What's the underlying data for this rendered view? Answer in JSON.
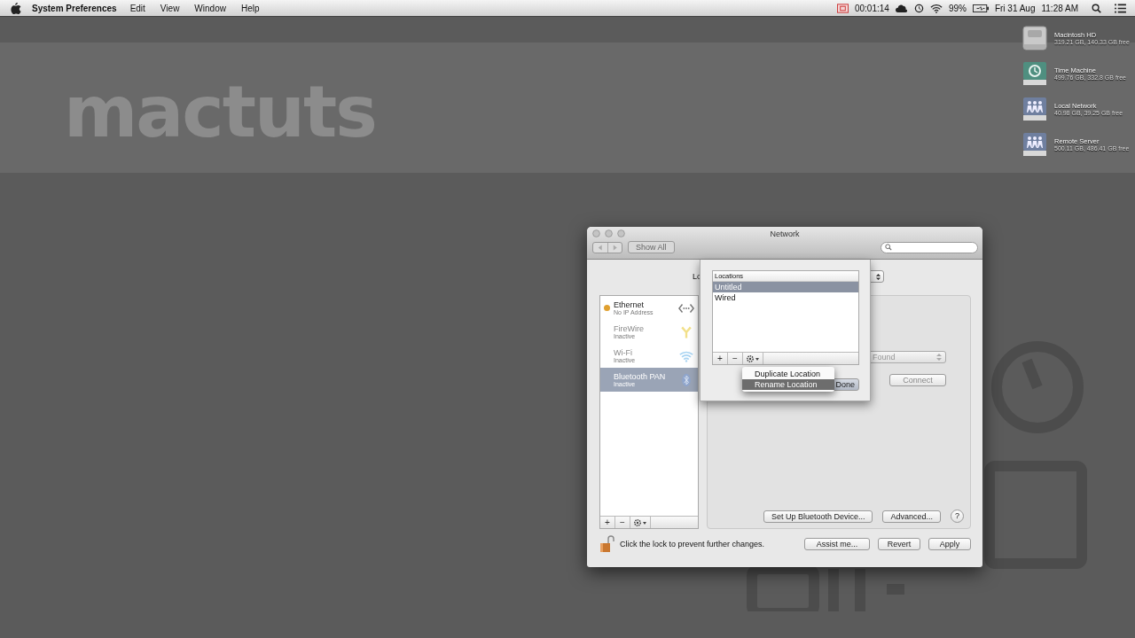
{
  "menubar": {
    "app": "System Preferences",
    "menus": [
      "Edit",
      "View",
      "Window",
      "Help"
    ],
    "timer": "00:01:14",
    "battery": "99%",
    "date": "Fri 31 Aug",
    "time": "11:28 AM"
  },
  "banner": {
    "logo": "mactuts"
  },
  "desktop_icons": [
    {
      "kind": "disk",
      "name": "Macintosh HD",
      "info": "319.21 GB, 140.33 GB free"
    },
    {
      "kind": "backup",
      "name": "Time Machine",
      "info": "499.76 GB, 332.8 GB free"
    },
    {
      "kind": "network",
      "name": "Local Network",
      "info": "40.98 GB, 39.25 GB free"
    },
    {
      "kind": "network",
      "name": "Remote Server",
      "info": "500.11 GB, 486.41 GB free"
    }
  ],
  "window": {
    "title": "Network",
    "show_all": "Show All",
    "location_label": "Lo",
    "services": [
      {
        "kind": "ethernet",
        "name": "Ethernet",
        "status": "No IP Address",
        "selected": false,
        "color": "#e0a030"
      },
      {
        "kind": "firewire",
        "name": "FireWire",
        "status": "Inactive",
        "selected": false
      },
      {
        "kind": "wifi",
        "name": "Wi-Fi",
        "status": "Inactive",
        "selected": false
      },
      {
        "kind": "bluetooth",
        "name": "Bluetooth PAN",
        "status": "Inactive",
        "selected": true
      }
    ],
    "list_buttons": [
      "+",
      "−"
    ],
    "device_popup": "Found",
    "connect": "Connect",
    "panel_buttons": [
      "Set Up Bluetooth Device...",
      "Advanced..."
    ],
    "help": "?",
    "lock_text": "Click the lock to prevent further changes.",
    "buttons": [
      "Assist me...",
      "Revert",
      "Apply"
    ],
    "sheet": {
      "header": "Locations",
      "rows": [
        {
          "name": "Untitled",
          "selected": true
        },
        {
          "name": "Wired",
          "selected": false
        }
      ],
      "list_buttons": [
        "+",
        "−"
      ],
      "menu": [
        {
          "label": "Duplicate Location",
          "selected": false
        },
        {
          "label": "Rename Location",
          "selected": true
        }
      ],
      "done": "Done"
    }
  }
}
